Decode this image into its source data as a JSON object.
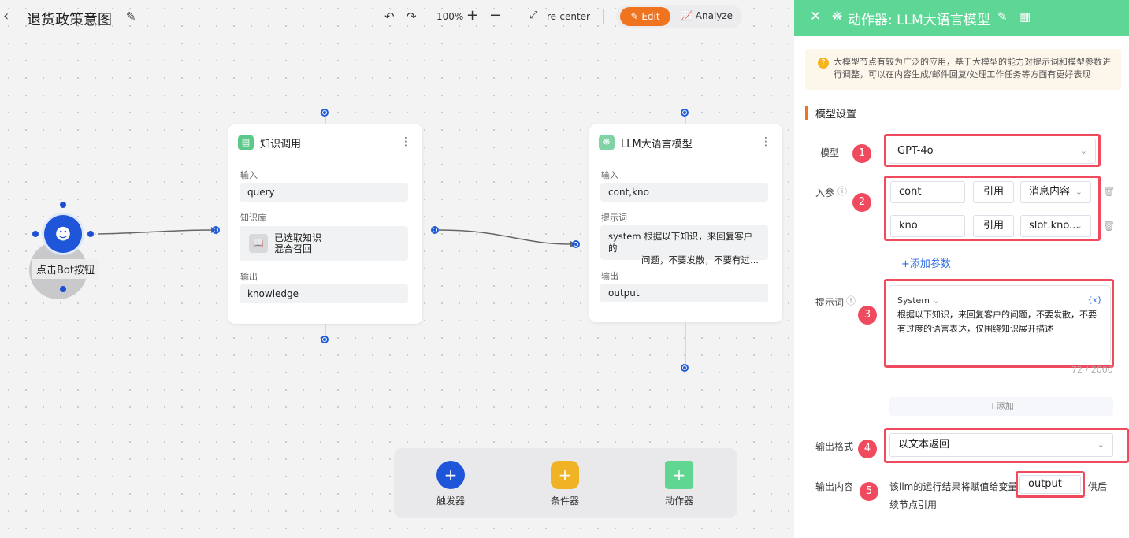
{
  "topbar": {
    "title": "退货政策意图",
    "zoom": "100%",
    "recenter": "re-center",
    "edit": "Edit",
    "analyze": "Analyze"
  },
  "trigger": {
    "label": "点击Bot按钮"
  },
  "node1": {
    "title": "知识调用",
    "input_label": "输入",
    "input_value": "query",
    "kb_label": "知识库",
    "kb_line1": "已选取知识",
    "kb_line2": "混合召回",
    "output_label": "输出",
    "output_value": "knowledge"
  },
  "node2": {
    "title": "LLM大语言模型",
    "input_label": "输入",
    "input_value": "cont,kno",
    "prompt_label": "提示词",
    "prompt_line1": "system 根据以下知识，来回复客户的",
    "prompt_line2": "问题，不要发散，不要有过...",
    "output_label": "输出",
    "output_value": "output"
  },
  "bottom": {
    "trigger": "触发器",
    "condition": "条件器",
    "action": "动作器"
  },
  "panel": {
    "title": "动作器: LLM大语言模型",
    "tip": "大模型节点有较为广泛的应用，基于大模型的能力对提示词和模型参数进行调整，可以在内容生成/邮件回复/处理工作任务等方面有更好表现",
    "section": "模型设置",
    "model_label": "模型",
    "model_value": "GPT-4o",
    "params_label": "入参",
    "params": [
      {
        "name": "cont",
        "ref": "引用",
        "source": "消息内容"
      },
      {
        "name": "kno",
        "ref": "引用",
        "source": "slot.kno..."
      }
    ],
    "add_param": "+添加参数",
    "prompt_label": "提示词",
    "prompt_role": "System",
    "prompt_var": "{x}",
    "prompt_text": "根据以下知识，来回复客户的问题，不要发散，不要有过度的语言表达，仅围绕知识展开描述",
    "prompt_count": "72 / 2000",
    "add": "+添加",
    "format_label": "输出格式",
    "format_value": "以文本返回",
    "out_label": "输出内容",
    "out_pre": "该llm的运行结果将赋值给变量",
    "out_var": "output",
    "out_post_1": "供后",
    "out_post_2": "续节点引用",
    "badges": [
      "1",
      "2",
      "3",
      "4",
      "5"
    ]
  },
  "colors": {
    "accent": "#f0731f",
    "header": "#5ed796",
    "port": "#1e5bd8",
    "highlight": "#ef4a5d"
  }
}
